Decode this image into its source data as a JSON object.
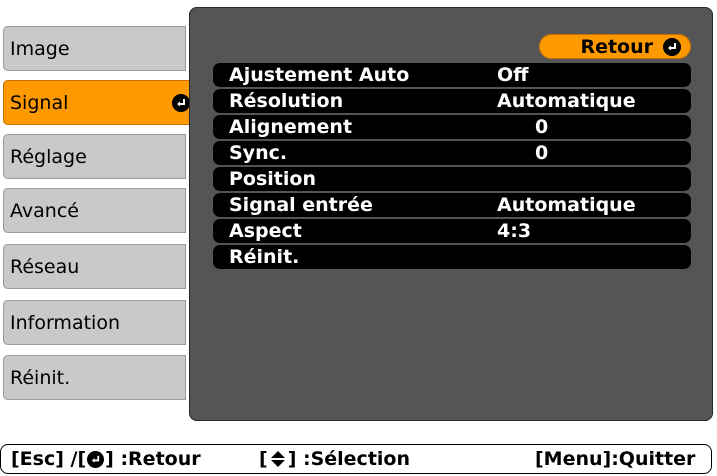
{
  "sidebar": {
    "items": [
      {
        "label": "Image"
      },
      {
        "label": "Signal"
      },
      {
        "label": "Réglage"
      },
      {
        "label": "Avancé"
      },
      {
        "label": "Réseau"
      },
      {
        "label": "Information"
      },
      {
        "label": "Réinit."
      }
    ],
    "active_index": 1
  },
  "panel": {
    "back_button": "Retour",
    "rows": [
      {
        "label": "Ajustement Auto",
        "value": "Off"
      },
      {
        "label": "Résolution",
        "value": "Automatique"
      },
      {
        "label": "Alignement",
        "value": "0"
      },
      {
        "label": "Sync.",
        "value": "0"
      },
      {
        "label": "Position",
        "value": ""
      },
      {
        "label": "Signal entrée",
        "value": "Automatique"
      },
      {
        "label": "Aspect",
        "value": "4:3"
      },
      {
        "label": "Réinit.",
        "value": ""
      }
    ]
  },
  "statusbar": {
    "esc_hint_a": "[Esc] /[",
    "esc_hint_b": "] :Retour",
    "select_hint_a": "[",
    "select_hint_b": "] :Sélection",
    "menu_hint": "[Menu]:Quitter"
  },
  "colors": {
    "accent": "#ff9900",
    "panel_bg": "#555555",
    "menu_bg": "#c9c9c9",
    "row_bg": "#000000"
  }
}
